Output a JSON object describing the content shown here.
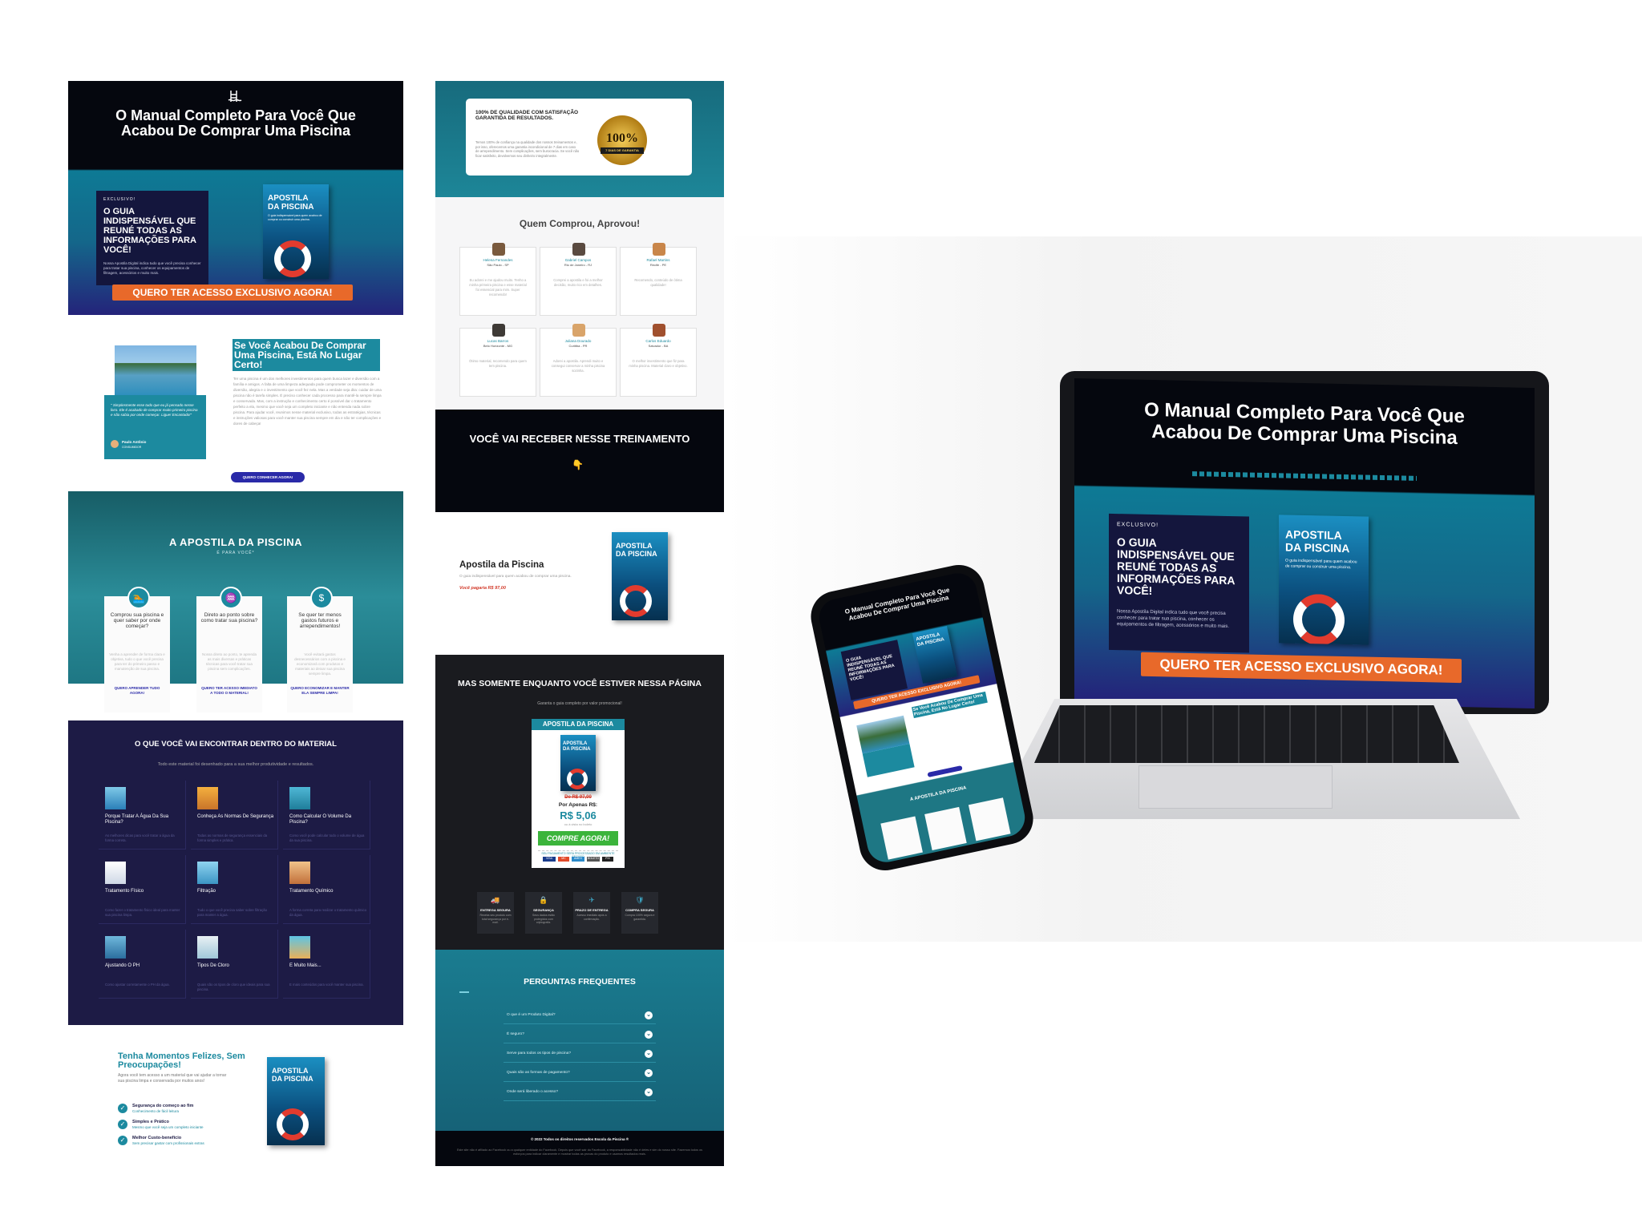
{
  "hero": {
    "title": "O Manual Completo Para Você Que Acabou De Comprar Uma Piscina",
    "exclusive_label": "EXCLUSIVO!",
    "card_headline": "O GUIA INDISPENSÁVEL QUE REUNÉ TODAS AS INFORMAÇÕES PARA VOCÊ!",
    "card_text": "Nossa Apostila Digital indica tudo que você precisa conhecer para tratar sua piscina, conhecer os equipamentos de filtragem, acessórios e muito mais.",
    "cta": "QUERO TER ACESSO EXCLUSIVO AGORA!"
  },
  "book": {
    "title_line1": "APOSTILA",
    "title_line2": "DA PISCINA",
    "subtitle": "O guia indispensável para quem acabou de comprar ou construir uma piscina."
  },
  "intro": {
    "heading": "Se Você Acabou De Comprar Uma Piscina, Está No Lugar Certo!",
    "body": "Ter uma piscina é um dos melhores investimentos para quem busca lazer e diversão com a família e amigos. A falta de uma limpeza adequada pode comprometer os momentos de diversão, alegria e o investimento que você fez nela. Mas a verdade seja dita: cuidar de uma piscina não é tarefa simples. É preciso conhecer cada processo para mantê-la sempre limpa e conservada. Mas, com a instrução e conhecimento certo é possível dar o tratamento perfeito a ela, mesmo que você seja um completo iniciante e não entenda nada sobre piscina. Para ajudar você, reunimos nesse material exclusivo, todas as estratégias, técnicas e instruções valiosas para você manter sua piscina sempre em dia e não ter complicações e dores de cabeça!",
    "quote": "\" Simplesmente esse tudo que eu já pensado nesse livro. Ele é acabado de comprar muito primeiro piscina e não sabia por onde começar. Ligue! Encantado!\"",
    "quote_author": "Paulo Antônio",
    "quote_role": "CONSUMIDOR",
    "button": "QUERO CONHECER AGORA!"
  },
  "features": {
    "title": "A APOSTILA DA PISCINA",
    "subtitle": "É PARA VOCÊ*",
    "cards": [
      {
        "icon": "swimmer-icon",
        "glyph": "🏊",
        "title": "Comprou sua piscina e quer saber por onde começar?",
        "desc": "Venha a aprender de forma clara e objetiva, tudo o que você precisa para ter do primeiro passo e manutenção de sua piscina.",
        "link": "QUERO APRENDER TUDO AGORA!"
      },
      {
        "icon": "pool-ladder-icon",
        "glyph": "♒",
        "title": "Direto ao ponto sobre como tratar sua piscina?",
        "desc": "Nossa direto ao ponto, te aprenda as mais diversas e práticas técnicas para você tratar sua piscina sem complicações.",
        "link": "QUERO TER ACESSO IMEDIATO A TODO O MATERIAL!"
      },
      {
        "icon": "money-icon",
        "glyph": "$",
        "title": "Se quer ter menos gastos futuros e arrependimentos!",
        "desc": "Você evitará gastos desnecessários com a piscina e economizará com produtos e materiais ao deixar sua piscina sempre limpa.",
        "link": "QUERO ECONOMIZAR E MANTER ELA SEMPRE LIMPA!"
      }
    ]
  },
  "material": {
    "title": "O QUE VOCÊ VAI ENCONTRAR DENTRO DO MATERIAL",
    "subtitle": "Todo este material foi desenhado para a sua melhor produtividade e resultados.",
    "items": [
      {
        "icon": "water-icon",
        "title": "Porque Tratar A Água Da Sua Piscina?",
        "desc": "As melhores dicas para você tratar a água da forma correta."
      },
      {
        "icon": "worker-icon",
        "title": "Conheça As Normas De Segurança",
        "desc": "Todas as normas de segurança essenciais da forma simples e prática."
      },
      {
        "icon": "pool-icon",
        "title": "Como Calcular O Volume Da Piscina?",
        "desc": "Como você pode calcular todo o volume de água da sua piscina."
      },
      {
        "icon": "brush-icon",
        "title": "Tratamento Físico",
        "desc": "Como fazer o tratamento físico ideal para manter sua piscina limpa."
      },
      {
        "icon": "filter-icon",
        "title": "Filtração",
        "desc": "Tudo o que você precisa saber sobre filtração para manter a água."
      },
      {
        "icon": "chemical-icon",
        "title": "Tratamento Químico",
        "desc": "A forma correta para realizar o tratamento químico da água."
      },
      {
        "icon": "ph-icon",
        "title": "Ajustando O PH",
        "desc": "Como ajustar corretamente o PH da água."
      },
      {
        "icon": "chlorine-icon",
        "title": "Tipos De Cloro",
        "desc": "Quais são os tipos de cloro que ideais para sua piscina."
      },
      {
        "icon": "more-icon",
        "title": "E Muito Mais...",
        "desc": "E mais conteúdos para você manter sua piscina."
      }
    ]
  },
  "happy": {
    "heading": "Tenha Momentos Felizes, Sem Preocupações!",
    "body": "Agora você tem acesso a um material que vai ajudar a tornar sua piscina limpa e conservada por muitos anos!",
    "checks": [
      {
        "title": "Segurança do começo ao fim",
        "desc": "Conhecimento de fácil leitura"
      },
      {
        "title": "Simples e Prático",
        "desc": "Mesmo que você seja um completo iniciante"
      },
      {
        "title": "Melhor Custo-benefício",
        "desc": "Sem precisar gastar com profissionais extras"
      }
    ]
  },
  "quality": {
    "title": "100% DE QUALIDADE COM SATISFAÇÃO GARANTIDA DE RESULTADOS.",
    "body": "Temos 100% de confiança na qualidade dos nossos treinamentos e, por isso, oferecemos uma garantia incondicional de 7 dias em caso de arrependimento. Sem complicações, sem burocracia. Se você não ficar satisfeito, devolvemos seu dinheiro integralmente.",
    "seal_value": "100%",
    "seal_text": "7 DIAS DE GARANTIA"
  },
  "testimonials": {
    "title": "Quem Comprou, Aprovou!",
    "items": [
      {
        "name": "Helena Fernandes",
        "loc": "São Paulo - SP",
        "text": "Eu adorei e me ajudou muito. Tenho a minha primeira piscina e esse material foi essencial para mim. Super recomendo!"
      },
      {
        "name": "Gabriel Campos",
        "loc": "Rio de Janeiro - RJ",
        "text": "Comprei a apostila e foi a melhor decisão, muito rico em detalhes."
      },
      {
        "name": "Rafael Martins",
        "loc": "Recife - PE",
        "text": "Recomendo, conteúdo de ótima qualidade!"
      },
      {
        "name": "Lucas Barros",
        "loc": "Belo Horizonte - MG",
        "text": "Ótimo material, recomendo para quem tem piscina."
      },
      {
        "name": "Juliana Dourado",
        "loc": "Curitiba - PR",
        "text": "Adorei a apostila. Aprendi muito e consegui conservar a minha piscina sozinha."
      },
      {
        "name": "Carlos Eduardo",
        "loc": "Salvador - BA",
        "text": "O melhor investimento que fiz para minha piscina. Material claro e objetivo."
      }
    ]
  },
  "receive": {
    "title": "VOCÊ VAI RECEBER NESSE TREINAMENTO",
    "emoji": "👇"
  },
  "product": {
    "name": "Apostila da Piscina",
    "desc": "O guia indispensável para quem acabou de comprar uma piscina.",
    "price_line": "Você pagaria R$ 97,00"
  },
  "offer": {
    "title": "MAS SOMENTE ENQUANTO VOCÊ ESTIVER NESSA PÁGINA",
    "subtitle": "Garanta o guia completo por valor promocional!",
    "card_title": "APOSTILA DA PISCINA",
    "old_price": "De R$ 97,00",
    "apenas": "Por Apenas R$:",
    "price": "R$ 5,06",
    "installments": "ou à vista no boleto",
    "buy": "COMPRE AGORA!",
    "payment_label": "SEU PAGAMENTO SERÁ PROCESSADO EM AMBIENTE SEGURO",
    "payment_icons": [
      "VISA",
      "MC",
      "AMEX",
      "BOLETO",
      "PIX"
    ]
  },
  "guarantees": [
    {
      "icon": "truck-icon",
      "glyph": "🚚",
      "title": "ENTREGA SEGURA",
      "desc": "Receba seu produto com total segurança por e-mail."
    },
    {
      "icon": "lock-icon",
      "glyph": "🔒",
      "title": "SEGURANÇA",
      "desc": "Seus dados estão protegidos com criptografia."
    },
    {
      "icon": "plane-icon",
      "glyph": "✈",
      "title": "PRAZO DE ENTREGA",
      "desc": "Acesso imediato após a confirmação."
    },
    {
      "icon": "shield-icon",
      "glyph": "🛡",
      "title": "COMPRA SEGURA",
      "desc": "Compra 100% segura e garantida."
    }
  ],
  "faq": {
    "title": "PERGUNTAS FREQUENTES",
    "items": [
      "O que é um Produto Digital?",
      "É seguro?",
      "Serve para todos os tipos de piscina?",
      "Quais são as formas de pagamento?",
      "Onde será liberado o acesso?"
    ]
  },
  "footer": {
    "copyright": "© 2022 Todos os direitos reservados Escola da Piscina ®",
    "disclaimer": "Este site não é afiliado ao Facebook ou a qualquer entidade do Facebook. Depois que você sair do Facebook, a responsabilidade não é deles e sim do nosso site. Fazemos todos os esforços para indicar claramente e mostrar todas as provas do produto e usamos resultados reais."
  },
  "colors": {
    "teal": "#1c8a9f",
    "navy": "#1d1b45",
    "orange": "#e8692a",
    "green": "#3bb43b",
    "black": "#05070e"
  }
}
